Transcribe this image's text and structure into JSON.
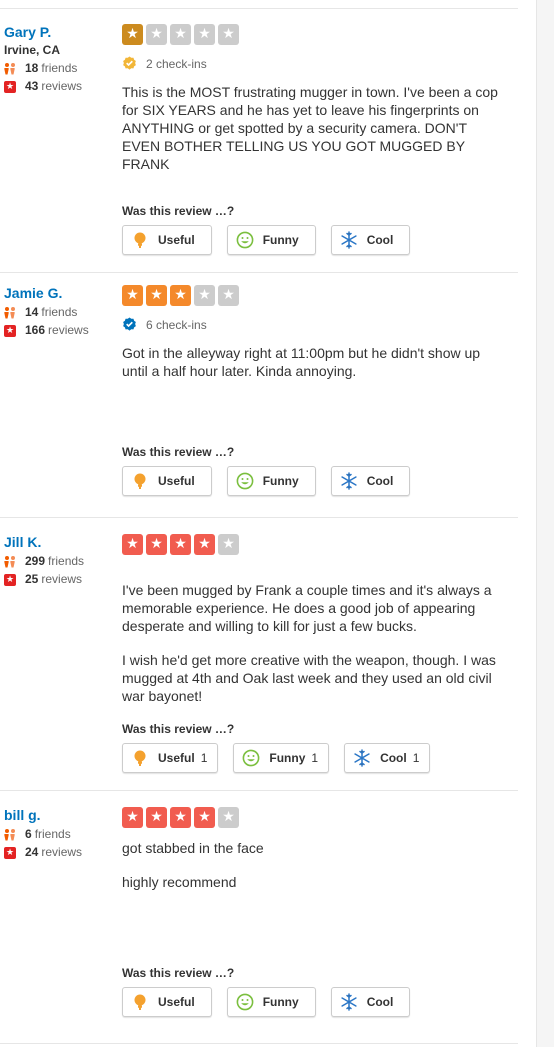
{
  "colors": {
    "link_blue": "#0073bb",
    "star_1": "#cc8b1f",
    "star_3": "#f4892b",
    "star_4": "#f15c4f",
    "star_empty": "#cccccc",
    "friends_orange": "#f15c00",
    "reviews_red": "#e32323",
    "checkin_gold": "#f2b638",
    "checkin_blue": "#0073bb"
  },
  "helpful_prompt": "Was this review …?",
  "votes": {
    "useful": "Useful",
    "funny": "Funny",
    "cool": "Cool"
  },
  "icons": {
    "friends": "friends-icon",
    "reviews": "reviews-star-icon",
    "checkin": "checkin-badge-icon",
    "useful": "lightbulb-icon",
    "funny": "smiley-icon",
    "cool": "snowflake-icon"
  },
  "reviews": [
    {
      "user": {
        "name": "Gary P.",
        "location": "Irvine, CA",
        "friends": "18",
        "friends_label": "friends",
        "reviews": "43",
        "reviews_label": "reviews"
      },
      "rating": 1,
      "checkins": "2 check-ins",
      "checkin_color": "gold",
      "paragraphs": [
        "This is the MOST frustrating mugger in town. I've been a cop for SIX YEARS and he has yet to leave his fingerprints on ANYTHING or get spotted by a security camera. DON'T EVEN BOTHER TELLING US YOU GOT MUGGED BY FRANK"
      ],
      "counts": {
        "useful": "",
        "funny": "",
        "cool": ""
      }
    },
    {
      "user": {
        "name": "Jamie G.",
        "location": "",
        "friends": "14",
        "friends_label": "friends",
        "reviews": "166",
        "reviews_label": "reviews"
      },
      "rating": 3,
      "checkins": "6 check-ins",
      "checkin_color": "blue",
      "paragraphs": [
        "Got in the alleyway right at 11:00pm but he didn't show up until a half hour later. Kinda annoying."
      ],
      "counts": {
        "useful": "",
        "funny": "",
        "cool": ""
      }
    },
    {
      "user": {
        "name": "Jill K.",
        "location": "",
        "friends": "299",
        "friends_label": "friends",
        "reviews": "25",
        "reviews_label": "reviews"
      },
      "rating": 4,
      "checkins": "",
      "checkin_color": "",
      "paragraphs": [
        "I've been mugged by Frank a couple times and it's always a memorable experience. He does a good job of appearing desperate and willing to kill for just a few bucks.",
        "I wish he'd get more creative with the weapon, though. I was mugged at 4th and Oak last week and they used an old civil war bayonet!"
      ],
      "counts": {
        "useful": "1",
        "funny": "1",
        "cool": "1"
      }
    },
    {
      "user": {
        "name": "bill g.",
        "location": "",
        "friends": "6",
        "friends_label": "friends",
        "reviews": "24",
        "reviews_label": "reviews"
      },
      "rating": 4,
      "checkins": "",
      "checkin_color": "",
      "paragraphs": [
        "got stabbed in the face",
        "highly recommend"
      ],
      "counts": {
        "useful": "",
        "funny": "",
        "cool": ""
      }
    }
  ]
}
